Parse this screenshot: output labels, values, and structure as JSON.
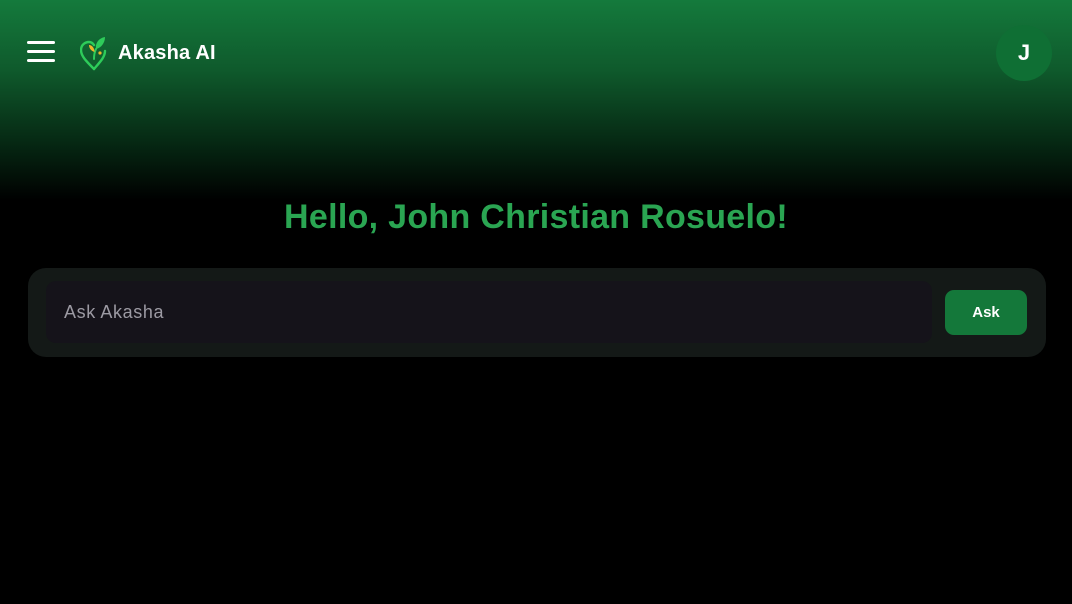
{
  "header": {
    "menu_icon": "hamburger-menu-icon",
    "brand_icon": "akasha-heart-sprout-logo-icon",
    "brand_name": "Akasha AI",
    "avatar_initial": "J"
  },
  "main": {
    "greeting": "Hello, John Christian Rosuelo!",
    "ask": {
      "placeholder": "Ask Akasha",
      "value": "",
      "button_label": "Ask"
    }
  },
  "colors": {
    "header_gradient_top": "#147a3c",
    "background": "#000000",
    "greeting_text": "#2aa552",
    "accent_button": "#14783a",
    "avatar_bg": "#0f6f34",
    "panel_bg": "#141917",
    "input_bg": "#15131a"
  }
}
